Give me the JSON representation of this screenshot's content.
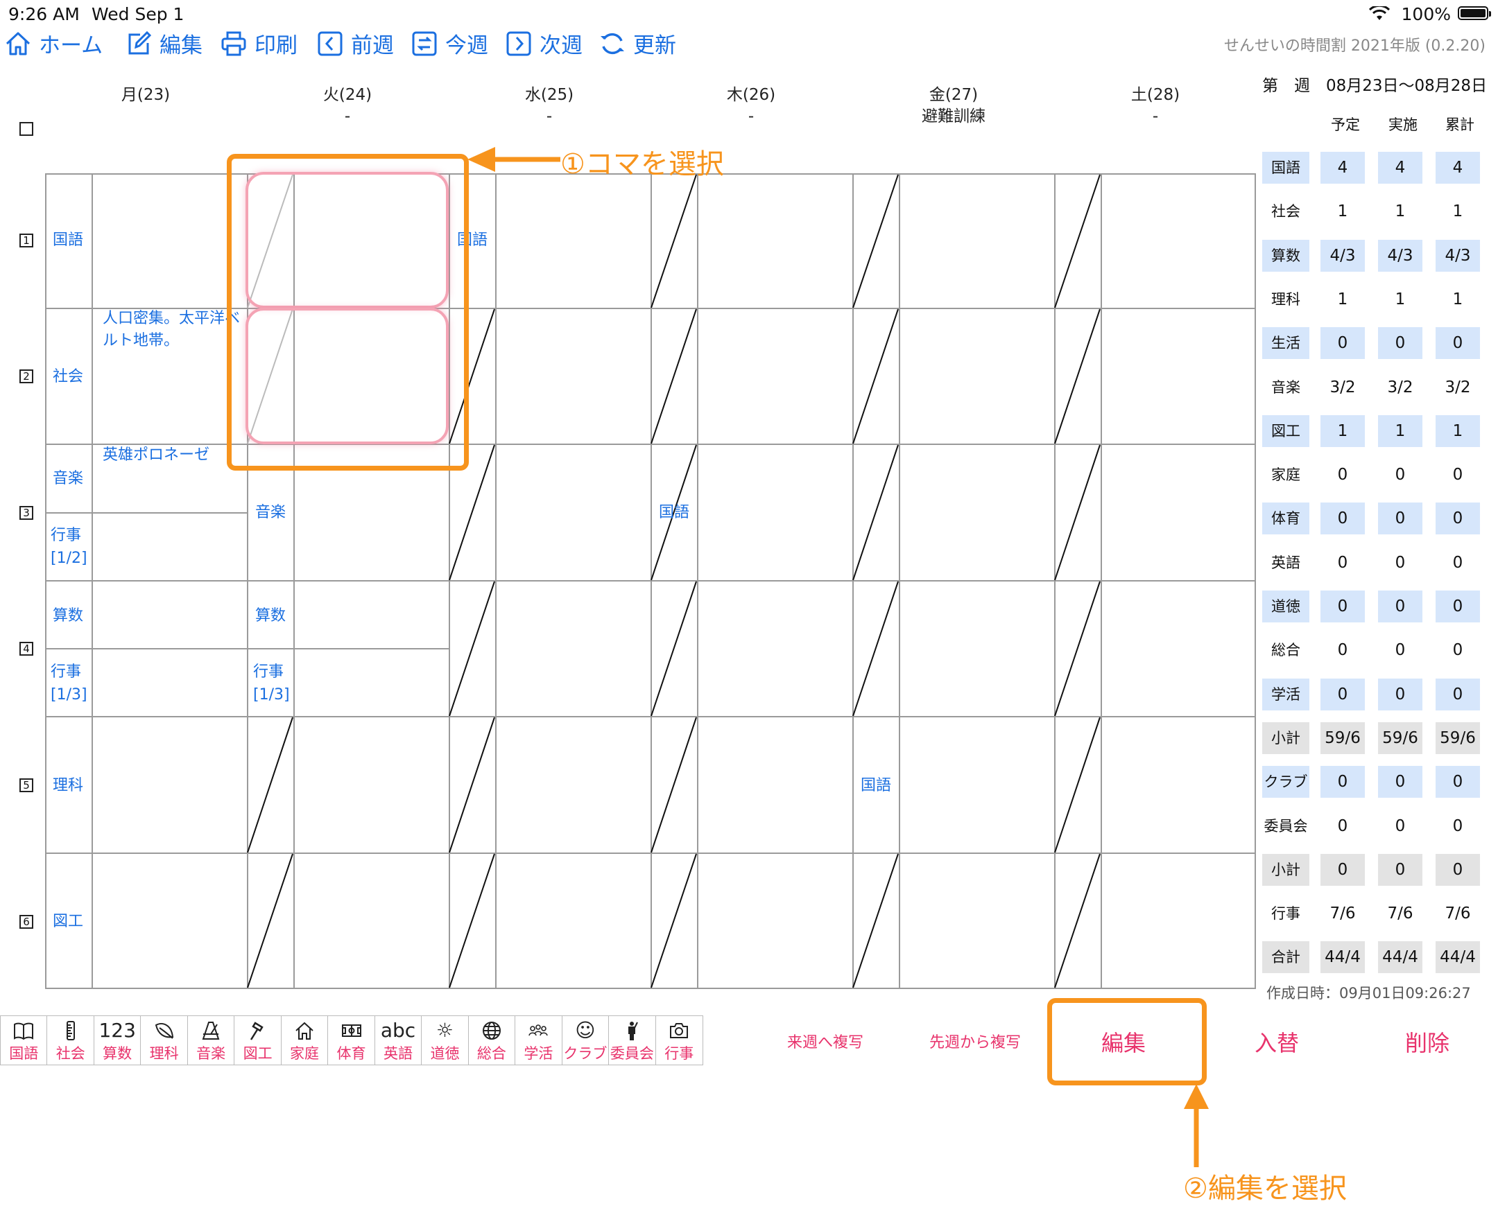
{
  "status": {
    "time": "9:26 AM",
    "date": "Wed Sep 1",
    "battery": "100%"
  },
  "toolbar": {
    "home": "ホーム",
    "edit": "編集",
    "print": "印刷",
    "prev_week": "前週",
    "this_week": "今週",
    "next_week": "次週",
    "refresh": "更新"
  },
  "app_version": "せんせいの時間割 2021年版 (0.2.20)",
  "days": [
    {
      "label": "月(23)",
      "sub1": "",
      "sub2": ""
    },
    {
      "label": "火(24)",
      "sub1": "-",
      "sub2": ""
    },
    {
      "label": "水(25)",
      "sub1": "-",
      "sub2": ""
    },
    {
      "label": "木(26)",
      "sub1": "-",
      "sub2": ""
    },
    {
      "label": "金(27)",
      "sub1": "避難訓練",
      "sub2": ""
    },
    {
      "label": "土(28)",
      "sub1": "-",
      "sub2": ""
    }
  ],
  "periods": [
    "1",
    "2",
    "3",
    "4",
    "5",
    "6"
  ],
  "cells": {
    "mon_p1": "国語",
    "mon_p2": "社会",
    "mon_p2_memo": "人口密集。太平洋ベルト地帯。",
    "mon_p3a": "音楽",
    "mon_p3a_memo": "英雄ポロネーゼ",
    "mon_p3b": "行事\n[1/2]",
    "mon_p4a": "算数",
    "mon_p4b": "行事\n[1/3]",
    "mon_p5": "理科",
    "mon_p6": "図工",
    "tue_p3": "音楽",
    "tue_p4a": "算数",
    "tue_p4b": "行事\n[1/3]",
    "wed_p1": "国語",
    "thu_p3": "国語",
    "fri_p5": "国語"
  },
  "summary": {
    "week_label": "第　週　08月23日〜08月28日",
    "col_headers": [
      "予定",
      "実施",
      "累計"
    ],
    "rows": [
      {
        "label": "国語",
        "values": [
          "4",
          "4",
          "4"
        ],
        "bg": "blue"
      },
      {
        "label": "社会",
        "values": [
          "1",
          "1",
          "1"
        ],
        "bg": "none"
      },
      {
        "label": "算数",
        "values": [
          "4/3",
          "4/3",
          "4/3"
        ],
        "bg": "blue"
      },
      {
        "label": "理科",
        "values": [
          "1",
          "1",
          "1"
        ],
        "bg": "none"
      },
      {
        "label": "生活",
        "values": [
          "0",
          "0",
          "0"
        ],
        "bg": "blue"
      },
      {
        "label": "音楽",
        "values": [
          "3/2",
          "3/2",
          "3/2"
        ],
        "bg": "none"
      },
      {
        "label": "図工",
        "values": [
          "1",
          "1",
          "1"
        ],
        "bg": "blue"
      },
      {
        "label": "家庭",
        "values": [
          "0",
          "0",
          "0"
        ],
        "bg": "none"
      },
      {
        "label": "体育",
        "values": [
          "0",
          "0",
          "0"
        ],
        "bg": "blue"
      },
      {
        "label": "英語",
        "values": [
          "0",
          "0",
          "0"
        ],
        "bg": "none"
      },
      {
        "label": "道徳",
        "values": [
          "0",
          "0",
          "0"
        ],
        "bg": "blue"
      },
      {
        "label": "総合",
        "values": [
          "0",
          "0",
          "0"
        ],
        "bg": "none"
      },
      {
        "label": "学活",
        "values": [
          "0",
          "0",
          "0"
        ],
        "bg": "blue"
      },
      {
        "label": "小計",
        "values": [
          "59/6",
          "59/6",
          "59/6"
        ],
        "bg": "gray"
      },
      {
        "label": "クラブ",
        "values": [
          "0",
          "0",
          "0"
        ],
        "bg": "blue"
      },
      {
        "label": "委員会",
        "values": [
          "0",
          "0",
          "0"
        ],
        "bg": "none"
      },
      {
        "label": "小計",
        "values": [
          "0",
          "0",
          "0"
        ],
        "bg": "gray"
      },
      {
        "label": "行事",
        "values": [
          "7/6",
          "7/6",
          "7/6"
        ],
        "bg": "none"
      },
      {
        "label": "合計",
        "values": [
          "44/4",
          "44/4",
          "44/4"
        ],
        "bg": "gray"
      }
    ],
    "created": "作成日時：09月01日09:26:27"
  },
  "palette": [
    {
      "label": "国語",
      "icon": "book-icon",
      "glyph": ""
    },
    {
      "label": "社会",
      "icon": "ruler-icon",
      "glyph": ""
    },
    {
      "label": "算数",
      "icon": "numbers-icon",
      "glyph": "123"
    },
    {
      "label": "理科",
      "icon": "leaf-icon",
      "glyph": ""
    },
    {
      "label": "音楽",
      "icon": "metronome-icon",
      "glyph": ""
    },
    {
      "label": "図工",
      "icon": "hammer-icon",
      "glyph": ""
    },
    {
      "label": "家庭",
      "icon": "house-icon",
      "glyph": ""
    },
    {
      "label": "体育",
      "icon": "field-icon",
      "glyph": ""
    },
    {
      "label": "英語",
      "icon": "abc-icon",
      "glyph": "abc"
    },
    {
      "label": "道徳",
      "icon": "sun-icon",
      "glyph": "☼"
    },
    {
      "label": "総合",
      "icon": "globe-icon",
      "glyph": ""
    },
    {
      "label": "学活",
      "icon": "people-icon",
      "glyph": ""
    },
    {
      "label": "クラブ",
      "icon": "smiley-icon",
      "glyph": "☺"
    },
    {
      "label": "委員会",
      "icon": "person-icon",
      "glyph": ""
    },
    {
      "label": "行事",
      "icon": "camera-icon",
      "glyph": ""
    }
  ],
  "actions": {
    "copy_next": "来週へ複写",
    "copy_prev": "先週から複写",
    "edit": "編集",
    "swap": "入替",
    "delete": "削除"
  },
  "annotations": {
    "step1": "①コマを選択",
    "step2": "②編集を選択"
  },
  "colors": {
    "accent_blue": "#1b6fe0",
    "accent_pink": "#e8336c",
    "annotation_orange": "#f7941d",
    "selection_pink": "#f4a3b4"
  }
}
